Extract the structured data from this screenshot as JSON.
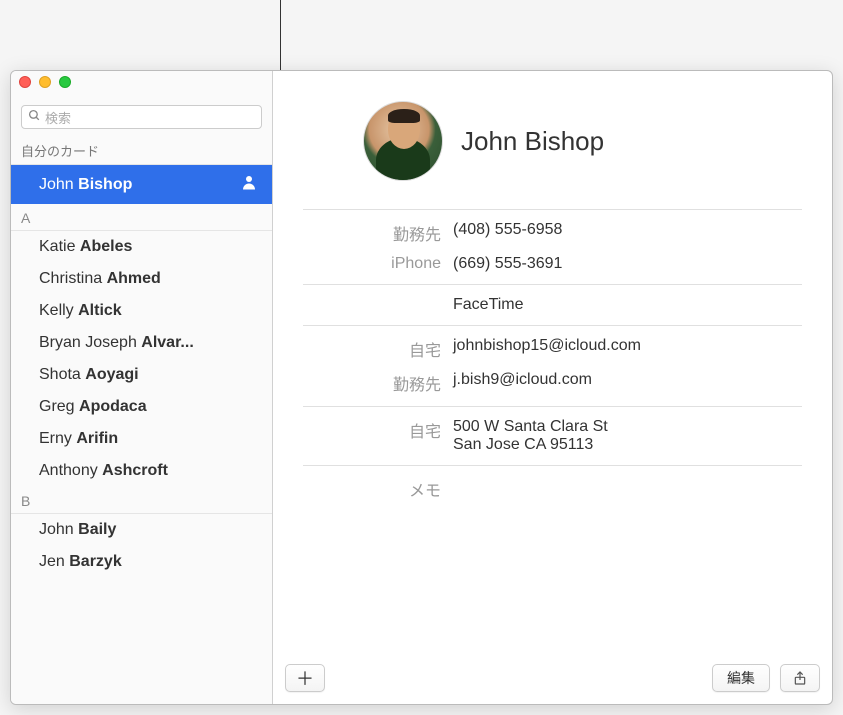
{
  "search": {
    "placeholder": "検索"
  },
  "sections": {
    "my_card_header": "自分のカード",
    "my_card": {
      "first": "John",
      "last": "Bishop"
    },
    "a_header": "A",
    "a_contacts": [
      {
        "first": "Katie",
        "last": "Abeles"
      },
      {
        "first": "Christina",
        "last": "Ahmed"
      },
      {
        "first": "Kelly",
        "last": "Altick"
      },
      {
        "first": "Bryan Joseph",
        "last": "Alvar..."
      },
      {
        "first": "Shota",
        "last": "Aoyagi"
      },
      {
        "first": "Greg",
        "last": "Apodaca"
      },
      {
        "first": "Erny",
        "last": "Arifin"
      },
      {
        "first": "Anthony",
        "last": "Ashcroft"
      }
    ],
    "b_header": "B",
    "b_contacts": [
      {
        "first": "John",
        "last": "Baily"
      },
      {
        "first": "Jen",
        "last": "Barzyk"
      }
    ]
  },
  "detail": {
    "name": "John Bishop",
    "phones": [
      {
        "label": "勤務先",
        "value": "(408) 555-6958"
      },
      {
        "label": "iPhone",
        "value": "(669) 555-3691"
      }
    ],
    "facetime_label": "FaceTime",
    "emails": [
      {
        "label": "自宅",
        "value": "johnbishop15@icloud.com"
      },
      {
        "label": "勤務先",
        "value": "j.bish9@icloud.com"
      }
    ],
    "address": {
      "label": "自宅",
      "line1": "500 W Santa Clara St",
      "line2": "San Jose CA 95113"
    },
    "notes_label": "メモ"
  },
  "buttons": {
    "edit": "編集"
  }
}
